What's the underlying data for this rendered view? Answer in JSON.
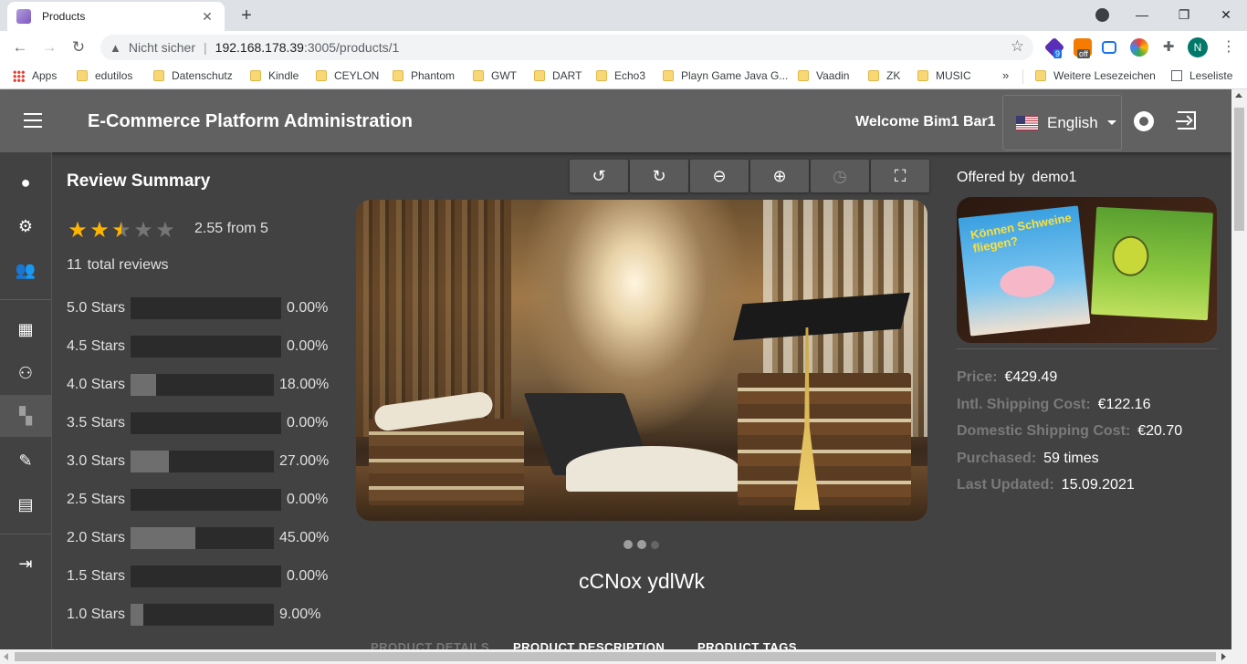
{
  "browser": {
    "tab_title": "Products",
    "insecure_label": "Nicht sicher",
    "url_host": "192.168.178.39",
    "url_path": ":3005/products/1",
    "profile_initial": "N",
    "ext_badge_1": "9",
    "ext_badge_2": "off",
    "bookmarks": [
      "Apps",
      "edutilos",
      "Datenschutz",
      "Kindle",
      "CEYLON",
      "Phantom",
      "GWT",
      "DART",
      "Echo3",
      "Playn Game Java G...",
      "Vaadin",
      "ZK",
      "MUSIC"
    ],
    "more_bookmarks": "»",
    "other_bookmarks": "Weitere Lesezeichen",
    "reading_list": "Leseliste"
  },
  "header": {
    "title": "E-Commerce Platform Administration",
    "welcome": "Welcome Bim1 Bar1",
    "language": "English"
  },
  "side_nav": {
    "items": [
      "person-icon",
      "settings-icon",
      "people-icon",
      "apps-icon",
      "group-icon",
      "dashboard-icon",
      "gavel-icon",
      "receipt-icon",
      "login-icon"
    ]
  },
  "review_summary": {
    "title": "Review Summary",
    "rating": 2.55,
    "rating_text": "2.55 from 5",
    "total_count": "11",
    "total_label": "total reviews",
    "rows": [
      {
        "label": "5.0 Stars",
        "percent": "0.00%",
        "fraction": 0.0
      },
      {
        "label": "4.5 Stars",
        "percent": "0.00%",
        "fraction": 0.0
      },
      {
        "label": "4.0 Stars",
        "percent": "18.00%",
        "fraction": 0.18
      },
      {
        "label": "3.5 Stars",
        "percent": "0.00%",
        "fraction": 0.0
      },
      {
        "label": "3.0 Stars",
        "percent": "27.00%",
        "fraction": 0.27
      },
      {
        "label": "2.5 Stars",
        "percent": "0.00%",
        "fraction": 0.0
      },
      {
        "label": "2.0 Stars",
        "percent": "45.00%",
        "fraction": 0.45
      },
      {
        "label": "1.5 Stars",
        "percent": "0.00%",
        "fraction": 0.0
      },
      {
        "label": "1.0 Stars",
        "percent": "9.00%",
        "fraction": 0.09
      }
    ]
  },
  "gallery": {
    "toolbar": [
      "rotate-left-icon",
      "rotate-right-icon",
      "zoom-out-icon",
      "zoom-in-icon",
      "reset-history-icon",
      "fullscreen-icon"
    ],
    "slide_count": 3,
    "active_slide": 1
  },
  "product": {
    "name": "cCNox ydlWk",
    "tabs": [
      "PRODUCT DETAILS",
      "PRODUCT DESCRIPTION",
      "PRODUCT TAGS"
    ]
  },
  "seller": {
    "offered_label": "Offered by",
    "name": "demo1",
    "price_label": "Price:",
    "price": "€429.49",
    "intl_label": "Intl. Shipping Cost:",
    "intl": "€122.16",
    "domestic_label": "Domestic Shipping Cost:",
    "domestic": "€20.70",
    "purchased_label": "Purchased:",
    "purchased": "59 times",
    "updated_label": "Last Updated:",
    "updated": "15.09.2021"
  },
  "box_art": {
    "game1_title": "Können Schweine fliegen?"
  }
}
